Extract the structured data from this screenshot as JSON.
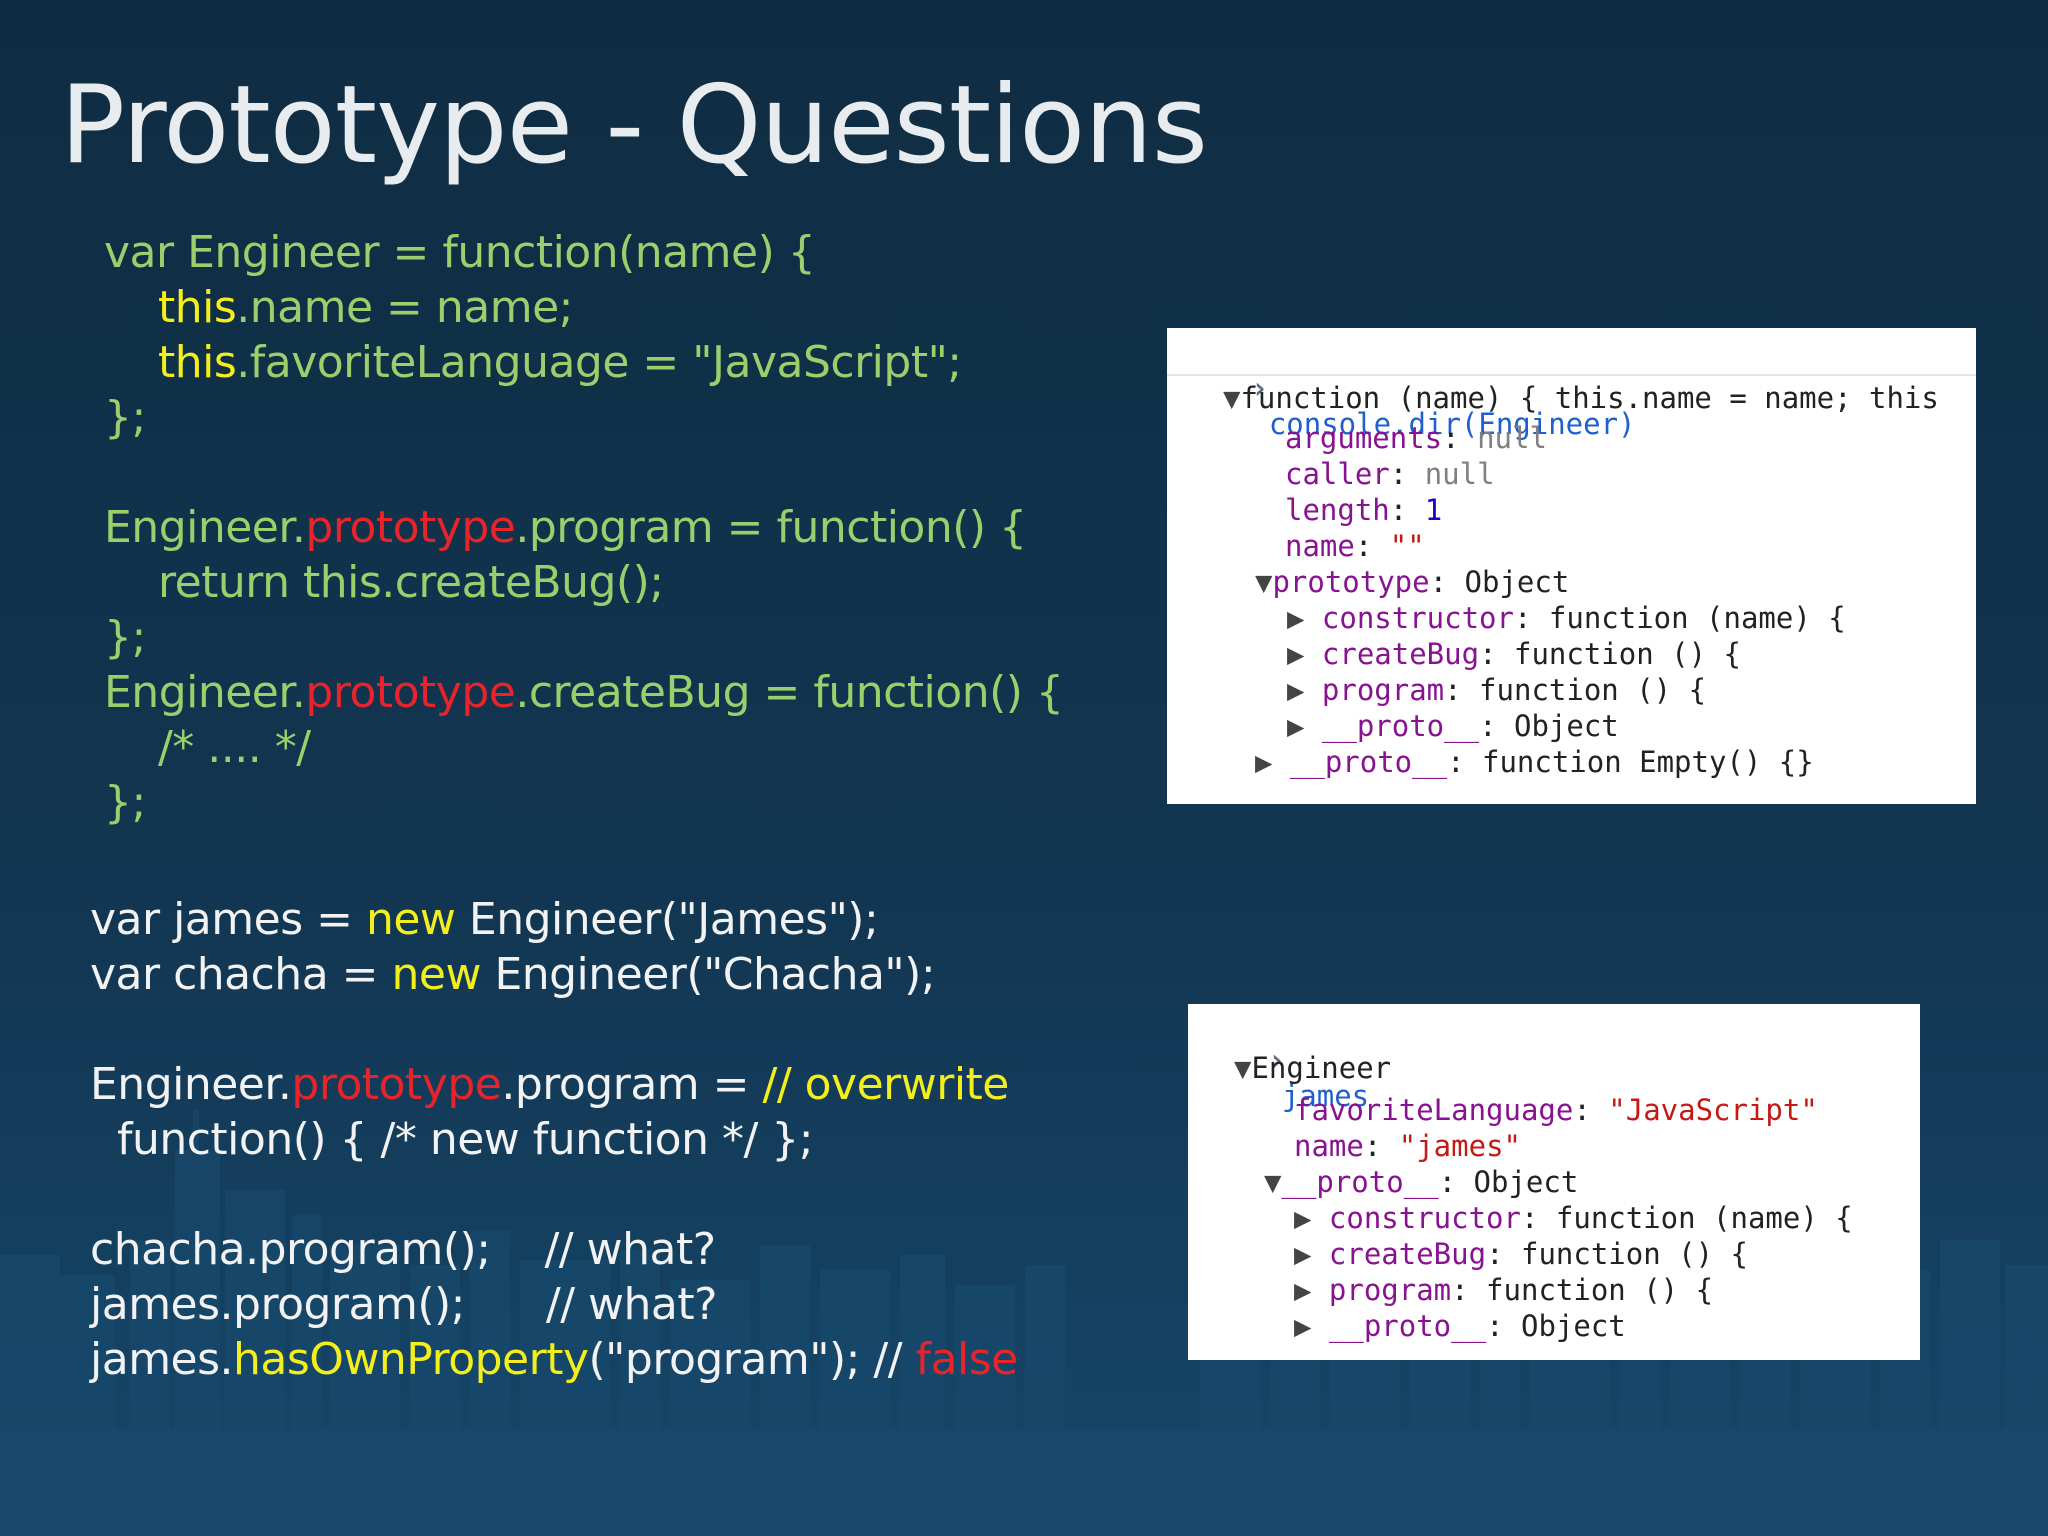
{
  "slide": {
    "title": "Prototype - Questions"
  },
  "code_block_1": [
    [
      {
        "t": "var Engineer = function(name) {",
        "c": "green"
      }
    ],
    [
      {
        "t": "    ",
        "c": "green"
      },
      {
        "t": "this",
        "c": "yellow"
      },
      {
        "t": ".name = name;",
        "c": "green"
      }
    ],
    [
      {
        "t": "    ",
        "c": "green"
      },
      {
        "t": "this",
        "c": "yellow"
      },
      {
        "t": ".favoriteLanguage = \"JavaScript\";",
        "c": "green"
      }
    ],
    [
      {
        "t": "};",
        "c": "green"
      }
    ],
    [
      {
        "t": "",
        "c": "green"
      }
    ],
    [
      {
        "t": "Engineer.",
        "c": "green"
      },
      {
        "t": "prototype",
        "c": "red"
      },
      {
        "t": ".program = function() {",
        "c": "green"
      }
    ],
    [
      {
        "t": "    return this.createBug();",
        "c": "green"
      }
    ],
    [
      {
        "t": "};",
        "c": "green"
      }
    ],
    [
      {
        "t": "Engineer.",
        "c": "green"
      },
      {
        "t": "prototype",
        "c": "red"
      },
      {
        "t": ".createBug = function() {",
        "c": "green"
      }
    ],
    [
      {
        "t": "    /* .... */",
        "c": "green"
      }
    ],
    [
      {
        "t": "};",
        "c": "green"
      }
    ]
  ],
  "code_block_2": [
    [
      {
        "t": "var james = ",
        "c": "white"
      },
      {
        "t": "new",
        "c": "yellow"
      },
      {
        "t": " Engineer(\"James\");",
        "c": "white"
      }
    ],
    [
      {
        "t": "var chacha = ",
        "c": "white"
      },
      {
        "t": "new",
        "c": "yellow"
      },
      {
        "t": " Engineer(\"Chacha\");",
        "c": "white"
      }
    ],
    [
      {
        "t": "",
        "c": "white"
      }
    ],
    [
      {
        "t": "Engineer.",
        "c": "white"
      },
      {
        "t": "prototype",
        "c": "red"
      },
      {
        "t": ".program = ",
        "c": "white"
      },
      {
        "t": "// overwrite",
        "c": "yellow"
      }
    ],
    [
      {
        "t": "  function() { /* new function */ };",
        "c": "white"
      }
    ],
    [
      {
        "t": "",
        "c": "white"
      }
    ],
    [
      {
        "t": "chacha.program();    // what?",
        "c": "white"
      }
    ],
    [
      {
        "t": "james.program();      // what?",
        "c": "white"
      }
    ],
    [
      {
        "t": "james.",
        "c": "white"
      },
      {
        "t": "hasOwnProperty",
        "c": "yellow"
      },
      {
        "t": "(\"program\"); // ",
        "c": "white"
      },
      {
        "t": "false",
        "c": "red"
      }
    ]
  ],
  "console_1": {
    "command": "console.dir(Engineer)",
    "rows": [
      [
        {
          "t": "▼",
          "c": "tri"
        },
        {
          "t": "function (name) { this.name = name; this",
          "c": ""
        }
      ],
      [
        {
          "t": "arguments",
          "c": "prop"
        },
        {
          "t": ": ",
          "c": ""
        },
        {
          "t": "null",
          "c": "gray"
        }
      ],
      [
        {
          "t": "caller",
          "c": "prop"
        },
        {
          "t": ": ",
          "c": ""
        },
        {
          "t": "null",
          "c": "gray"
        }
      ],
      [
        {
          "t": "length",
          "c": "prop"
        },
        {
          "t": ": ",
          "c": ""
        },
        {
          "t": "1",
          "c": "num"
        }
      ],
      [
        {
          "t": "name",
          "c": "prop"
        },
        {
          "t": ": ",
          "c": ""
        },
        {
          "t": "\"\"",
          "c": "str"
        }
      ],
      [
        {
          "t": "▼",
          "c": "tri"
        },
        {
          "t": "prototype",
          "c": "prop"
        },
        {
          "t": ": Object",
          "c": ""
        }
      ],
      [
        {
          "t": "▶ ",
          "c": "tri"
        },
        {
          "t": "constructor",
          "c": "prop"
        },
        {
          "t": ": function (name) {",
          "c": ""
        }
      ],
      [
        {
          "t": "▶ ",
          "c": "tri"
        },
        {
          "t": "createBug",
          "c": "prop"
        },
        {
          "t": ": function () {",
          "c": ""
        }
      ],
      [
        {
          "t": "▶ ",
          "c": "tri"
        },
        {
          "t": "program",
          "c": "prop"
        },
        {
          "t": ": function () {",
          "c": ""
        }
      ],
      [
        {
          "t": "▶ ",
          "c": "tri"
        },
        {
          "t": "__proto__",
          "c": "prop"
        },
        {
          "t": ": Object",
          "c": ""
        }
      ],
      [
        {
          "t": "▶ ",
          "c": "tri"
        },
        {
          "t": "__proto__",
          "c": "prop"
        },
        {
          "t": ": function Empty() {}",
          "c": ""
        }
      ]
    ]
  },
  "console_2": {
    "command": "james",
    "rows": [
      [
        {
          "t": "▼",
          "c": "tri"
        },
        {
          "t": "Engineer",
          "c": ""
        }
      ],
      [
        {
          "t": "favoriteLanguage",
          "c": "prop"
        },
        {
          "t": ": ",
          "c": ""
        },
        {
          "t": "\"JavaScript\"",
          "c": "str"
        }
      ],
      [
        {
          "t": "name",
          "c": "prop"
        },
        {
          "t": ": ",
          "c": ""
        },
        {
          "t": "\"james\"",
          "c": "str"
        }
      ],
      [
        {
          "t": "▼",
          "c": "tri"
        },
        {
          "t": "__proto__",
          "c": "prop"
        },
        {
          "t": ": Object",
          "c": ""
        }
      ],
      [
        {
          "t": "▶ ",
          "c": "tri"
        },
        {
          "t": "constructor",
          "c": "prop"
        },
        {
          "t": ": function (name) {",
          "c": ""
        }
      ],
      [
        {
          "t": "▶ ",
          "c": "tri"
        },
        {
          "t": "createBug",
          "c": "prop"
        },
        {
          "t": ": function () {",
          "c": ""
        }
      ],
      [
        {
          "t": "▶ ",
          "c": "tri"
        },
        {
          "t": "program",
          "c": "prop"
        },
        {
          "t": ": function () {",
          "c": ""
        }
      ],
      [
        {
          "t": "▶ ",
          "c": "tri"
        },
        {
          "t": "__proto__",
          "c": "prop"
        },
        {
          "t": ": Object",
          "c": ""
        }
      ]
    ]
  },
  "colors": {
    "background": "#10314a",
    "code_green": "#9ccf6c",
    "code_white": "#f2f2f2",
    "keyword_yellow": "#f3ef1c",
    "highlight_red": "#e8242a"
  }
}
